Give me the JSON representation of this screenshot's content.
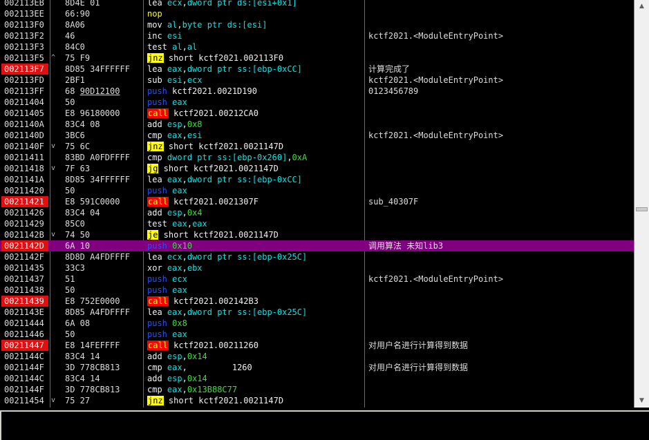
{
  "rows": [
    {
      "addr": "002113EB",
      "bp": false,
      "arrow": "",
      "bytes": [
        {
          "t": "8D4E 01"
        }
      ],
      "instr": [
        {
          "t": "lea"
        },
        {
          "t": " "
        },
        {
          "t": "ecx",
          "c": "m-c"
        },
        {
          "t": ","
        },
        {
          "t": "dword ptr ds:[esi+0x1]",
          "c": "m-c"
        }
      ],
      "comment": "",
      "hl": false
    },
    {
      "addr": "002113EE",
      "bp": false,
      "arrow": "",
      "bytes": [
        {
          "t": "66:90"
        }
      ],
      "instr": [
        {
          "t": "nop",
          "c": "m-g"
        }
      ],
      "comment": "",
      "hl": false
    },
    {
      "addr": "002113F0",
      "bp": false,
      "arrow": "",
      "bytes": [
        {
          "t": "8A06"
        }
      ],
      "instr": [
        {
          "t": "mov"
        },
        {
          "t": " "
        },
        {
          "t": "al",
          "c": "m-c"
        },
        {
          "t": ","
        },
        {
          "t": "byte ptr ds:[esi]",
          "c": "m-c"
        }
      ],
      "comment": "",
      "hl": false
    },
    {
      "addr": "002113F2",
      "bp": false,
      "arrow": "",
      "bytes": [
        {
          "t": "46"
        }
      ],
      "instr": [
        {
          "t": "inc"
        },
        {
          "t": " "
        },
        {
          "t": "esi",
          "c": "m-c"
        }
      ],
      "comment": "kctf2021.<ModuleEntryPoint>",
      "hl": false
    },
    {
      "addr": "002113F3",
      "bp": false,
      "arrow": "",
      "bytes": [
        {
          "t": "84C0"
        }
      ],
      "instr": [
        {
          "t": "test"
        },
        {
          "t": " "
        },
        {
          "t": "al",
          "c": "m-c"
        },
        {
          "t": ","
        },
        {
          "t": "al",
          "c": "m-c"
        }
      ],
      "comment": "",
      "hl": false
    },
    {
      "addr": "002113F5",
      "bp": false,
      "arrow": "^",
      "bytes": [
        {
          "t": "75 F9"
        }
      ],
      "instr": [
        {
          "t": "jnz",
          "c": "m-y"
        },
        {
          "t": " short kctf2021.002113F0"
        }
      ],
      "comment": "",
      "hl": false
    },
    {
      "addr": "002113F7",
      "bp": true,
      "arrow": "",
      "bytes": [
        {
          "t": "8D85 34FFFFFF"
        }
      ],
      "instr": [
        {
          "t": "lea"
        },
        {
          "t": " "
        },
        {
          "t": "eax",
          "c": "m-c"
        },
        {
          "t": ","
        },
        {
          "t": "dword ptr ss:[ebp-0xCC]",
          "c": "m-c"
        }
      ],
      "comment": "计算完成了",
      "hl": false
    },
    {
      "addr": "002113FD",
      "bp": false,
      "arrow": "",
      "bytes": [
        {
          "t": "2BF1"
        }
      ],
      "instr": [
        {
          "t": "sub"
        },
        {
          "t": " "
        },
        {
          "t": "esi",
          "c": "m-c"
        },
        {
          "t": ","
        },
        {
          "t": "ecx",
          "c": "m-c"
        }
      ],
      "comment": "kctf2021.<ModuleEntryPoint>",
      "hl": false
    },
    {
      "addr": "002113FF",
      "bp": false,
      "arrow": "",
      "bytes": [
        {
          "t": "68 "
        },
        {
          "t": "90D12100",
          "u": true
        }
      ],
      "instr": [
        {
          "t": "push",
          "c": "m-b"
        },
        {
          "t": " kctf2021.0021D190"
        }
      ],
      "comment": "0123456789",
      "hl": false
    },
    {
      "addr": "00211404",
      "bp": false,
      "arrow": "",
      "bytes": [
        {
          "t": "50"
        }
      ],
      "instr": [
        {
          "t": "push",
          "c": "m-b"
        },
        {
          "t": " "
        },
        {
          "t": "eax",
          "c": "m-c"
        }
      ],
      "comment": "",
      "hl": false
    },
    {
      "addr": "00211405",
      "bp": false,
      "arrow": "",
      "bytes": [
        {
          "t": "E8 96180000"
        }
      ],
      "instr": [
        {
          "t": "call",
          "c": "m-r"
        },
        {
          "t": " kctf2021.00212CA0"
        }
      ],
      "comment": "",
      "hl": false
    },
    {
      "addr": "0021140A",
      "bp": false,
      "arrow": "",
      "bytes": [
        {
          "t": "83C4 08"
        }
      ],
      "instr": [
        {
          "t": "add"
        },
        {
          "t": " "
        },
        {
          "t": "esp",
          "c": "m-c"
        },
        {
          "t": ","
        },
        {
          "t": "0x8",
          "c": "num"
        }
      ],
      "comment": "",
      "hl": false
    },
    {
      "addr": "0021140D",
      "bp": false,
      "arrow": "",
      "bytes": [
        {
          "t": "3BC6"
        }
      ],
      "instr": [
        {
          "t": "cmp"
        },
        {
          "t": " "
        },
        {
          "t": "eax",
          "c": "m-c"
        },
        {
          "t": ","
        },
        {
          "t": "esi",
          "c": "m-c"
        }
      ],
      "comment": "kctf2021.<ModuleEntryPoint>",
      "hl": false
    },
    {
      "addr": "0021140F",
      "bp": false,
      "arrow": "v",
      "bytes": [
        {
          "t": "75 6C"
        }
      ],
      "instr": [
        {
          "t": "jnz",
          "c": "m-y"
        },
        {
          "t": " short kctf2021.0021147D"
        }
      ],
      "comment": "",
      "hl": false
    },
    {
      "addr": "00211411",
      "bp": false,
      "arrow": "",
      "bytes": [
        {
          "t": "83BD A0FDFFFF"
        }
      ],
      "instr": [
        {
          "t": "cmp"
        },
        {
          "t": " "
        },
        {
          "t": "dword ptr ss:[ebp-0x260]",
          "c": "m-c"
        },
        {
          "t": ","
        },
        {
          "t": "0xA",
          "c": "num"
        }
      ],
      "comment": "",
      "hl": false
    },
    {
      "addr": "00211418",
      "bp": false,
      "arrow": "v",
      "bytes": [
        {
          "t": "7F 63"
        }
      ],
      "instr": [
        {
          "t": "jg",
          "c": "m-y"
        },
        {
          "t": " short kctf2021.0021147D"
        }
      ],
      "comment": "",
      "hl": false
    },
    {
      "addr": "0021141A",
      "bp": false,
      "arrow": "",
      "bytes": [
        {
          "t": "8D85 34FFFFFF"
        }
      ],
      "instr": [
        {
          "t": "lea"
        },
        {
          "t": " "
        },
        {
          "t": "eax",
          "c": "m-c"
        },
        {
          "t": ","
        },
        {
          "t": "dword ptr ss:[ebp-0xCC]",
          "c": "m-c"
        }
      ],
      "comment": "",
      "hl": false
    },
    {
      "addr": "00211420",
      "bp": false,
      "arrow": "",
      "bytes": [
        {
          "t": "50"
        }
      ],
      "instr": [
        {
          "t": "push",
          "c": "m-b"
        },
        {
          "t": " "
        },
        {
          "t": "eax",
          "c": "m-c"
        }
      ],
      "comment": "",
      "hl": false
    },
    {
      "addr": "00211421",
      "bp": true,
      "arrow": "",
      "bytes": [
        {
          "t": "E8 591C0000"
        }
      ],
      "instr": [
        {
          "t": "call",
          "c": "m-r"
        },
        {
          "t": " kctf2021.0021307F"
        }
      ],
      "comment": "sub_40307F",
      "hl": false
    },
    {
      "addr": "00211426",
      "bp": false,
      "arrow": "",
      "bytes": [
        {
          "t": "83C4 04"
        }
      ],
      "instr": [
        {
          "t": "add"
        },
        {
          "t": " "
        },
        {
          "t": "esp",
          "c": "m-c"
        },
        {
          "t": ","
        },
        {
          "t": "0x4",
          "c": "num"
        }
      ],
      "comment": "",
      "hl": false
    },
    {
      "addr": "00211429",
      "bp": false,
      "arrow": "",
      "bytes": [
        {
          "t": "85C0"
        }
      ],
      "instr": [
        {
          "t": "test"
        },
        {
          "t": " "
        },
        {
          "t": "eax",
          "c": "m-c"
        },
        {
          "t": ","
        },
        {
          "t": "eax",
          "c": "m-c"
        }
      ],
      "comment": "",
      "hl": false
    },
    {
      "addr": "0021142B",
      "bp": false,
      "arrow": "v",
      "bytes": [
        {
          "t": "74 50"
        }
      ],
      "instr": [
        {
          "t": "je",
          "c": "m-y"
        },
        {
          "t": " short kctf2021.0021147D"
        }
      ],
      "comment": "",
      "hl": false
    },
    {
      "addr": "0021142D",
      "bp": true,
      "arrow": "",
      "bytes": [
        {
          "t": "6A 10"
        }
      ],
      "instr": [
        {
          "t": "push",
          "c": "m-b"
        },
        {
          "t": " "
        },
        {
          "t": "0x10",
          "c": "num"
        }
      ],
      "comment": "调用算法 未知lib3",
      "hl": true
    },
    {
      "addr": "0021142F",
      "bp": false,
      "arrow": "",
      "bytes": [
        {
          "t": "8D8D A4FDFFFF"
        }
      ],
      "instr": [
        {
          "t": "lea"
        },
        {
          "t": " "
        },
        {
          "t": "ecx",
          "c": "m-c"
        },
        {
          "t": ","
        },
        {
          "t": "dword ptr ss:[ebp-0x25C]",
          "c": "m-c"
        }
      ],
      "comment": "",
      "hl": false
    },
    {
      "addr": "00211435",
      "bp": false,
      "arrow": "",
      "bytes": [
        {
          "t": "33C3"
        }
      ],
      "instr": [
        {
          "t": "xor"
        },
        {
          "t": " "
        },
        {
          "t": "eax",
          "c": "m-c"
        },
        {
          "t": ","
        },
        {
          "t": "ebx",
          "c": "m-c"
        }
      ],
      "comment": "",
      "hl": false
    },
    {
      "addr": "00211437",
      "bp": false,
      "arrow": "",
      "bytes": [
        {
          "t": "51"
        }
      ],
      "instr": [
        {
          "t": "push",
          "c": "m-b"
        },
        {
          "t": " "
        },
        {
          "t": "ecx",
          "c": "m-c"
        }
      ],
      "comment": "kctf2021.<ModuleEntryPoint>",
      "hl": false
    },
    {
      "addr": "00211438",
      "bp": false,
      "arrow": "",
      "bytes": [
        {
          "t": "50"
        }
      ],
      "instr": [
        {
          "t": "push",
          "c": "m-b"
        },
        {
          "t": " "
        },
        {
          "t": "eax",
          "c": "m-c"
        }
      ],
      "comment": "",
      "hl": false
    },
    {
      "addr": "00211439",
      "bp": true,
      "arrow": "",
      "bytes": [
        {
          "t": "E8 752E0000"
        }
      ],
      "instr": [
        {
          "t": "call",
          "c": "m-r"
        },
        {
          "t": " kctf2021.002142B3"
        }
      ],
      "comment": "",
      "hl": false
    },
    {
      "addr": "0021143E",
      "bp": false,
      "arrow": "",
      "bytes": [
        {
          "t": "8D85 A4FDFFFF"
        }
      ],
      "instr": [
        {
          "t": "lea"
        },
        {
          "t": " "
        },
        {
          "t": "eax",
          "c": "m-c"
        },
        {
          "t": ","
        },
        {
          "t": "dword ptr ss:[ebp-0x25C]",
          "c": "m-c"
        }
      ],
      "comment": "",
      "hl": false
    },
    {
      "addr": "00211444",
      "bp": false,
      "arrow": "",
      "bytes": [
        {
          "t": "6A 08"
        }
      ],
      "instr": [
        {
          "t": "push",
          "c": "m-b"
        },
        {
          "t": " "
        },
        {
          "t": "0x8",
          "c": "num"
        }
      ],
      "comment": "",
      "hl": false
    },
    {
      "addr": "00211446",
      "bp": false,
      "arrow": "",
      "bytes": [
        {
          "t": "50"
        }
      ],
      "instr": [
        {
          "t": "push",
          "c": "m-b"
        },
        {
          "t": " "
        },
        {
          "t": "eax",
          "c": "m-c"
        }
      ],
      "comment": "",
      "hl": false
    },
    {
      "addr": "00211447",
      "bp": true,
      "arrow": "",
      "bytes": [
        {
          "t": "E8 14FEFFFF"
        }
      ],
      "instr": [
        {
          "t": "call",
          "c": "m-r"
        },
        {
          "t": " kctf2021.00211260"
        }
      ],
      "comment": "对用户名进行计算得到数据",
      "hl": false
    },
    {
      "addr": "0021144C",
      "bp": false,
      "arrow": "",
      "bytes": [
        {
          "t": "83C4 14"
        }
      ],
      "instr": [
        {
          "t": "add"
        },
        {
          "t": " "
        },
        {
          "t": "esp",
          "c": "m-c"
        },
        {
          "t": ","
        },
        {
          "t": "0x14",
          "c": "num"
        }
      ],
      "comment": "",
      "hl": false
    },
    {
      "addr": "0021144F",
      "bp": false,
      "arrow": "",
      "bytes": [
        {
          "t": "3D 778CB813"
        }
      ],
      "instr": [
        {
          "t": "cmp"
        },
        {
          "t": " "
        },
        {
          "t": "eax",
          "c": "m-c"
        },
        {
          "t": ",         1260"
        }
      ],
      "comment": "对用户名进行计算得到数据",
      "hl": false
    },
    {
      "addr": "0021144C",
      "bp": false,
      "arrow": "",
      "bytes": [
        {
          "t": "83C4 14"
        }
      ],
      "instr": [
        {
          "t": "add"
        },
        {
          "t": " "
        },
        {
          "t": "esp",
          "c": "m-c"
        },
        {
          "t": ","
        },
        {
          "t": "0x14",
          "c": "num"
        }
      ],
      "comment": "",
      "hl": false
    },
    {
      "addr": "0021144F",
      "bp": false,
      "arrow": "",
      "bytes": [
        {
          "t": "3D 778CB813"
        }
      ],
      "instr": [
        {
          "t": "cmp"
        },
        {
          "t": " "
        },
        {
          "t": "eax",
          "c": "m-c"
        },
        {
          "t": ","
        },
        {
          "t": "0x13B88C77",
          "c": "num"
        }
      ],
      "comment": "",
      "hl": false
    },
    {
      "addr": "00211454",
      "bp": false,
      "arrow": "v",
      "bytes": [
        {
          "t": "75 27"
        }
      ],
      "instr": [
        {
          "t": "jnz",
          "c": "m-y"
        },
        {
          "t": " short kctf2021.0021147D"
        }
      ],
      "comment": "",
      "hl": false
    }
  ],
  "scrollbar": {
    "up_arrow": "▲",
    "down_arrow": "▼",
    "up_icon": "triangle-up-icon",
    "down_icon": "triangle-down-icon"
  },
  "colors": {
    "breakpoint": "#e01010",
    "highlight_row": "#800080",
    "jump": "#ffff00",
    "call": "#ff0000",
    "push": "#2a4fff",
    "register": "#00e5e5",
    "immediate": "#36e036"
  }
}
